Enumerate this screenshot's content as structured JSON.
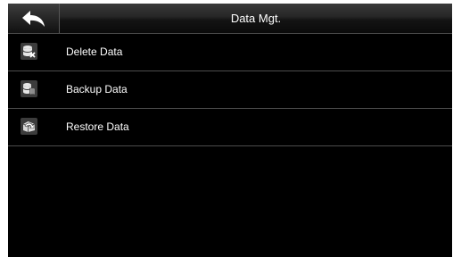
{
  "header": {
    "title": "Data Mgt.",
    "back_icon": "back-arrow-icon"
  },
  "menu": {
    "items": [
      {
        "label": "Delete Data",
        "icon": "delete-data-icon"
      },
      {
        "label": "Backup Data",
        "icon": "backup-data-icon"
      },
      {
        "label": "Restore Data",
        "icon": "restore-data-icon"
      }
    ]
  },
  "colors": {
    "background": "#000000",
    "header_gradient_top": "#3a3a3a",
    "header_gradient_bottom": "#0a0a0a",
    "divider": "#4d4d4d",
    "text": "#ffffff",
    "icon_tile": "#3c3c3c"
  }
}
